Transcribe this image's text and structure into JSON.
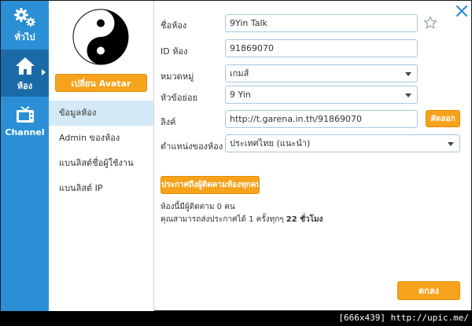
{
  "rail": {
    "items": [
      {
        "label": "ทั่วไป",
        "icon": "gears-icon"
      },
      {
        "label": "ห้อง",
        "icon": "home-icon"
      },
      {
        "label": "Channel",
        "icon": "tv-icon"
      }
    ]
  },
  "sidebar": {
    "avatar_button": "เปลี่ยน Avatar",
    "menu": [
      {
        "label": "ข้อมูลห้อง"
      },
      {
        "label": "Admin ของห้อง"
      },
      {
        "label": "แบนลิสต์ชื่อผู้ใช้งาน"
      },
      {
        "label": "แบนลิสต์ IP"
      }
    ]
  },
  "form": {
    "room_name_label": "ชื่อห้อง",
    "room_name_value": "9Yin Talk",
    "room_id_label": "ID ห้อง",
    "room_id_value": "91869070",
    "category_label": "หมวดหมู่",
    "category_value": "เกมส์",
    "subtopic_label": "หัวข้อย่อย",
    "subtopic_value": "9 Yin",
    "link_label": "ลิงค์",
    "link_value": "http://t.garena.in.th/91869070",
    "copy_button": "คัดลอก",
    "location_label": "ตำแหน่งของห้อง",
    "location_value": "ประเทศไทย (แนะนำ)"
  },
  "announce": {
    "button": "ประกาศถึงผู้ติดตามห้องทุกคน",
    "followers_text": "ห้องนี้มีผู้ติดตาม 0 คน",
    "limit_prefix": "คุณสามารถส่งประกาศได้ 1 ครั้งทุกๆ ",
    "limit_hours": "22 ชั่วโมง"
  },
  "ok_button": "ตกลง",
  "watermark": "[666x439] http://upic.me/",
  "colors": {
    "rail_bg": "#2a8fd4",
    "rail_active": "#1b6aa8",
    "accent_orange": "#f7a21b",
    "menu_active": "#d4e9f7",
    "close_blue": "#2a8fd4"
  }
}
